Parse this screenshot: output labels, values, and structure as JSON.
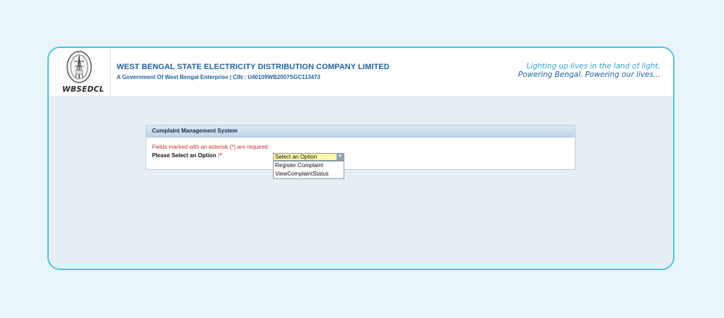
{
  "header": {
    "logo_text": "WBSEDCL",
    "company_name": "WEST BENGAL STATE ELECTRICITY DISTRIBUTION COMPANY LIMITED",
    "company_sub": "A Government Of West Bengal Enterprise | CIN : U40109WB2007SGC113473",
    "tagline_1": "Lighting up lives in the land of light.",
    "tagline_2": "Powering Bengal. Powering our lives..."
  },
  "panel": {
    "title": "Complaint Management System",
    "required_note": "Fields marked with an asterisk (*) are required",
    "option_label": "Please Select an Option :",
    "required_marker": "*"
  },
  "select": {
    "selected": "Select an Option",
    "options": [
      "Register Complaint",
      "ViewComplaintStatus"
    ]
  },
  "colors": {
    "accent_border": "#4cc3e3",
    "brand_blue": "#1f62a8",
    "tagline_light_blue": "#2ea3da",
    "required_red": "#cc3333",
    "select_highlight": "#fff9a8"
  }
}
